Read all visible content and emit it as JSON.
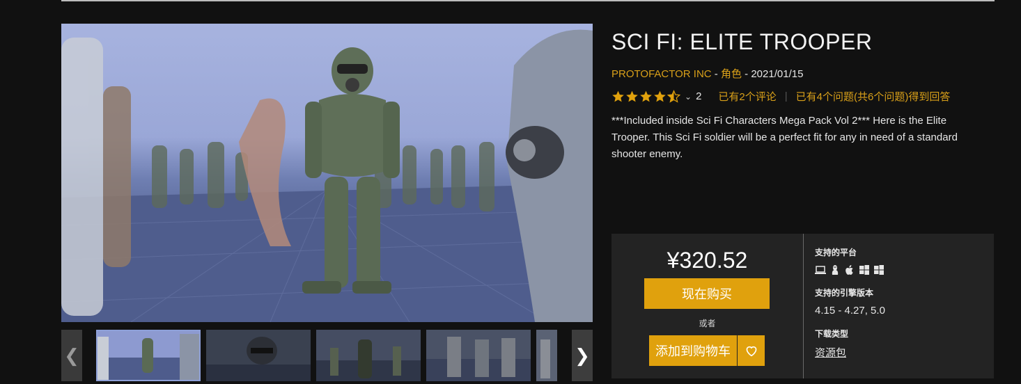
{
  "product": {
    "title": "SCI FI: ELITE TROOPER",
    "seller": "PROTOFACTOR INC",
    "category": "角色",
    "dash1": " - ",
    "dash2": " - ",
    "date": "2021/01/15",
    "rating_value": 4.5,
    "rating_count": "2",
    "reviews_link": "已有2个评论",
    "questions_link": "已有4个问题(共6个问题)得到回答",
    "description": "***Included inside Sci Fi Characters Mega Pack Vol 2*** Here is the Elite Trooper. This Sci Fi soldier will be a perfect fit for any in need of a standard shooter enemy."
  },
  "gallery": {
    "prev_icon": "chevron-left-icon",
    "next_icon": "chevron-right-icon",
    "thumb_count": 5
  },
  "purchase": {
    "price": "¥320.52",
    "buy_label": "现在购买",
    "or_label": "或者",
    "cart_label": "添加到购物车",
    "fav_icon": "heart-icon"
  },
  "specs": {
    "platforms_label": "支持的平台",
    "platform_icons": [
      "laptop-icon",
      "linux-icon",
      "apple-icon",
      "windows-icon",
      "windows-icon"
    ],
    "engine_label": "支持的引擎版本",
    "engine_value": "4.15 - 4.27, 5.0",
    "download_label": "下载类型",
    "download_value": "资源包"
  },
  "colors": {
    "accent": "#e0a10d",
    "link": "#d9a019",
    "background": "#111111",
    "panel": "#232323"
  }
}
